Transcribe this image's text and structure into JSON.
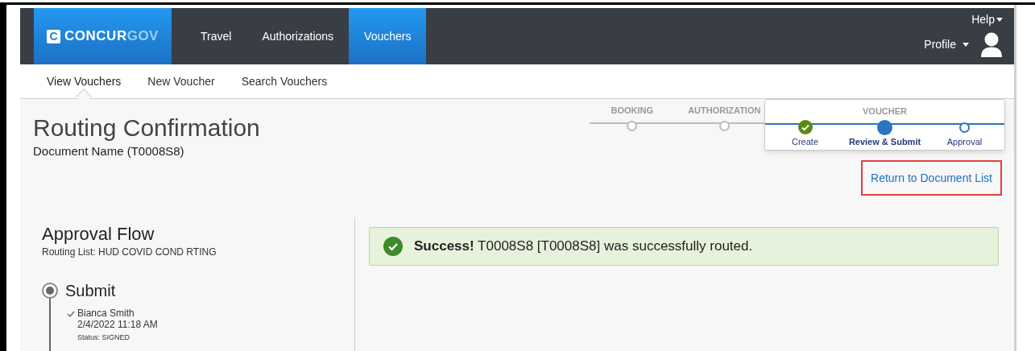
{
  "logo": {
    "mark": "C",
    "name": "CONCUR",
    "suffix": "GOV"
  },
  "nav": [
    {
      "label": "Travel",
      "selected": false
    },
    {
      "label": "Authorizations",
      "selected": false
    },
    {
      "label": "Vouchers",
      "selected": true
    }
  ],
  "help": "Help",
  "profile": "Profile",
  "subnav": [
    {
      "label": "View Vouchers",
      "selected": true
    },
    {
      "label": "New Voucher",
      "selected": false
    },
    {
      "label": "Search Vouchers",
      "selected": false
    }
  ],
  "title": "Routing Confirmation",
  "document_name": "Document Name (T0008S8)",
  "progress": {
    "stages": [
      {
        "label": "BOOKING"
      },
      {
        "label": "AUTHORIZATION"
      }
    ],
    "current_stage": {
      "label": "VOUCHER",
      "steps": [
        {
          "label": "Create",
          "completed": true,
          "selected": false
        },
        {
          "label": "Review & Submit",
          "completed": false,
          "selected": true
        },
        {
          "label": "Approval",
          "completed": false,
          "selected": false
        }
      ]
    }
  },
  "return_link": "Return to Document List",
  "approval_flow": {
    "title": "Approval Flow",
    "routing_list": "Routing List: HUD COVID COND RTING",
    "steps": [
      {
        "title": "Submit",
        "approvals": [
          {
            "name": "Bianca Smith",
            "date": "2/4/2022 11:18 AM",
            "status": "Status: SIGNED"
          }
        ]
      }
    ]
  },
  "success": "**Success!** T0008S8 [T0008S8] was successfully routed."
}
